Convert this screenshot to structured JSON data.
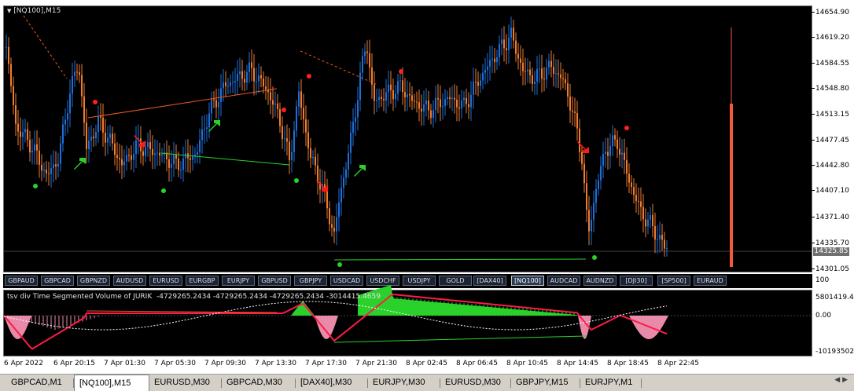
{
  "chart": {
    "title": "[NQ100],M15",
    "current_price": "14325.85",
    "price_labels": [
      "14654.90",
      "14619.20",
      "14584.55",
      "14548.80",
      "14513.15",
      "14477.45",
      "14442.80",
      "14407.10",
      "14371.40",
      "14335.70",
      "14301.05"
    ],
    "colors": {
      "up": "#1e6fd9",
      "down": "#f07c2e",
      "background": "#000000",
      "buy_arrow": "#2bd12b",
      "sell_arrow": "#ff1a1a",
      "dot_red": "#ff2020",
      "dot_green": "#2bd12b"
    }
  },
  "symbols": [
    "GBPAUD",
    "GBPCAD",
    "GBPNZD",
    "AUDUSD",
    "EURUSD",
    "EURGBP",
    "EURJPY",
    "GBPUSD",
    "GBPJPY",
    "USDCAD",
    "USDCHF",
    "USDJPY",
    "GOLD",
    "[DAX40]",
    "[NQ100]",
    "AUDCAD",
    "AUDNZD",
    "[DJI30]",
    "[SP500]",
    "EURAUD"
  ],
  "active_symbol": "[NQ100]",
  "indicator": {
    "title": "tsv div Time Segmented Volume of JURIK",
    "values": "-4729265.2434 -4729265.2434 -4729265.2434 -3014415.4659",
    "scale_top": "100",
    "scale_max": "5801419.46",
    "scale_zero": "0.00",
    "scale_min": "-10193502.."
  },
  "time_labels": [
    "6 Apr 2022",
    "6 Apr 20:15",
    "7 Apr 01:30",
    "7 Apr 05:30",
    "7 Apr 09:30",
    "7 Apr 13:30",
    "7 Apr 17:30",
    "7 Apr 21:30",
    "8 Apr 02:45",
    "8 Apr 06:45",
    "8 Apr 10:45",
    "8 Apr 14:45",
    "8 Apr 18:45",
    "8 Apr 22:45"
  ],
  "tabs": [
    "GBPCAD,M1",
    "[NQ100],M15",
    "EURUSD,M30",
    "GBPCAD,M30",
    "[DAX40],M30",
    "EURJPY,M30",
    "EURUSD,M30",
    "GBPJPY,M15",
    "EURJPY,M1"
  ],
  "active_tab": "[NQ100],M15"
}
